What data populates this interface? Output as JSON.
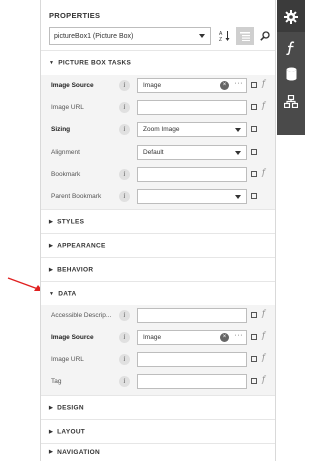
{
  "panel": {
    "title": "PROPERTIES",
    "selector_value": "pictureBox1 (Picture Box)"
  },
  "sections": {
    "picture_box_tasks": "PICTURE BOX TASKS",
    "styles": "STYLES",
    "appearance": "APPEARANCE",
    "behavior": "BEHAVIOR",
    "data": "DATA",
    "design": "DESIGN",
    "layout": "LAYOUT",
    "navigation": "NAVIGATION"
  },
  "tasks": [
    {
      "label": "Image Source",
      "value": "Image"
    },
    {
      "label": "Image URL",
      "value": ""
    },
    {
      "label": "Sizing",
      "value": "Zoom Image"
    },
    {
      "label": "Alignment",
      "value": "Default"
    },
    {
      "label": "Bookmark",
      "value": ""
    },
    {
      "label": "Parent Bookmark",
      "value": ""
    }
  ],
  "data_props": [
    {
      "label": "Accessible Descrip...",
      "value": ""
    },
    {
      "label": "Image Source",
      "value": "Image"
    },
    {
      "label": "Image URL",
      "value": ""
    },
    {
      "label": "Tag",
      "value": ""
    }
  ],
  "glyphs": {
    "info": "i",
    "expression": "f",
    "clear": "×",
    "ellipsis": "···",
    "collapsed": "▶",
    "expanded": "▼"
  },
  "icons": [
    "gear-icon",
    "function-icon",
    "database-icon",
    "sitemap-icon",
    "sort-az-icon",
    "categorized-icon",
    "search-icon"
  ]
}
